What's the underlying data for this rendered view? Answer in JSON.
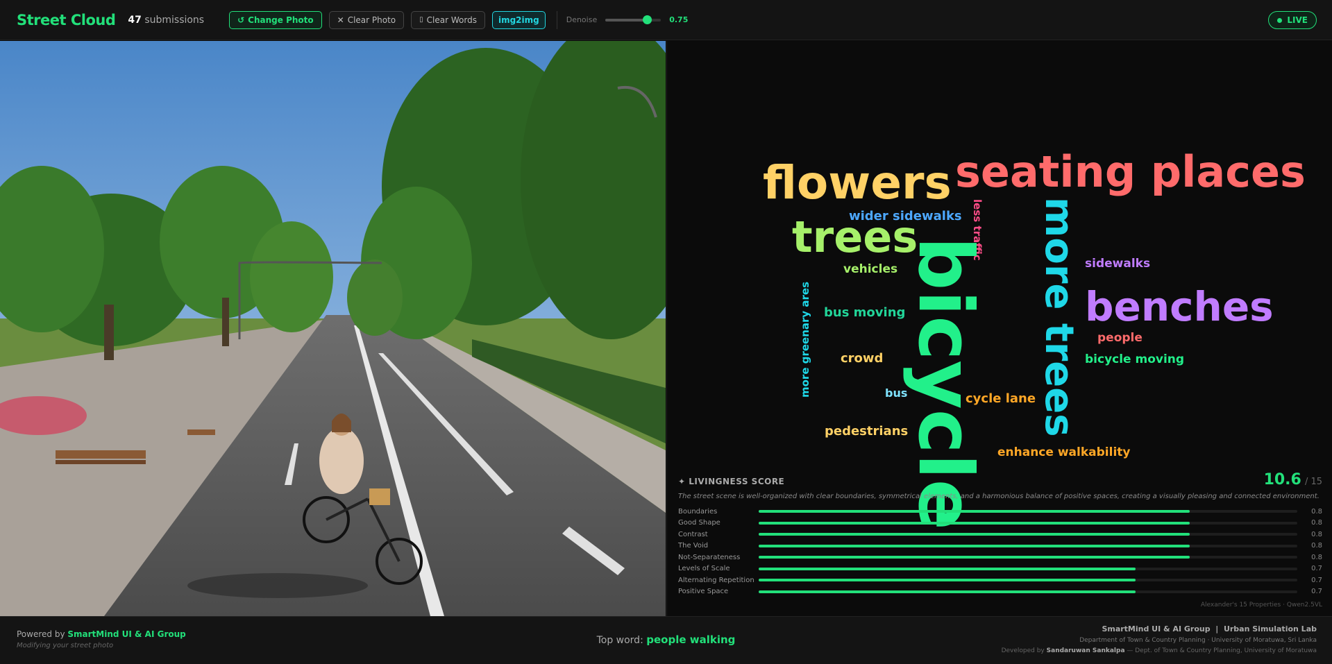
{
  "header": {
    "brand": "Street Cloud",
    "submissions_count": "47",
    "submissions_label": "submissions",
    "change_photo": "Change Photo",
    "clear_photo": "Clear Photo",
    "clear_words": "Clear Words",
    "mode": "img2img",
    "denoise_label": "Denoise",
    "denoise_value": "0.75",
    "denoise_fraction": 0.75,
    "live": "LIVE"
  },
  "cloud": {
    "words": [
      {
        "text": "seating places",
        "color": "#ff6b6b"
      },
      {
        "text": "flowers",
        "color": "#ffd166"
      },
      {
        "text": "wider sidewalks",
        "color": "#4da8ff"
      },
      {
        "text": "less traffic",
        "color": "#ff4d88"
      },
      {
        "text": "trees",
        "color": "#a6f06a"
      },
      {
        "text": "more trees",
        "color": "#1fd8e8"
      },
      {
        "text": "bicycle",
        "color": "#22f08a"
      },
      {
        "text": "vehicles",
        "color": "#a6f06a"
      },
      {
        "text": "sidewalks",
        "color": "#c07cff"
      },
      {
        "text": "more greenary ares",
        "color": "#1fd8e8"
      },
      {
        "text": "benches",
        "color": "#c07cff"
      },
      {
        "text": "bus moving",
        "color": "#22d69a"
      },
      {
        "text": "people",
        "color": "#ff6b6b"
      },
      {
        "text": "crowd",
        "color": "#ffd166"
      },
      {
        "text": "bicycle moving",
        "color": "#22f08a"
      },
      {
        "text": "bus",
        "color": "#7fe3ff"
      },
      {
        "text": "cycle lane",
        "color": "#ffa726"
      },
      {
        "text": "pedestrians",
        "color": "#ffd166"
      },
      {
        "text": "enhance walkability",
        "color": "#ffa726"
      }
    ]
  },
  "score": {
    "title": "LIVINGNESS SCORE",
    "value": "10.6",
    "max": "/ 15",
    "description": "The street scene is well-organized with clear boundaries, symmetrical elements, and a harmonious balance of positive spaces, creating a visually pleasing and connected environment.",
    "properties": [
      {
        "label": "Boundaries",
        "value": "0.8",
        "level": 0.8
      },
      {
        "label": "Good Shape",
        "value": "0.8",
        "level": 0.8
      },
      {
        "label": "Contrast",
        "value": "0.8",
        "level": 0.8
      },
      {
        "label": "The Void",
        "value": "0.8",
        "level": 0.8
      },
      {
        "label": "Not-Separateness",
        "value": "0.8",
        "level": 0.8
      },
      {
        "label": "Levels of Scale",
        "value": "0.7",
        "level": 0.7
      },
      {
        "label": "Alternating Repetition",
        "value": "0.7",
        "level": 0.7
      },
      {
        "label": "Positive Space",
        "value": "0.7",
        "level": 0.7
      }
    ],
    "credit": "Alexander's 15 Properties · Qwen2.5VL"
  },
  "footer": {
    "powered_prefix": "Powered by",
    "powered_by": "SmartMind UI & AI Group",
    "modifying": "Modifying your street photo",
    "top_word_label": "Top word:",
    "top_word": "people walking",
    "org_line": "SmartMind UI & AI Group  |  Urban Simulation Lab",
    "dept_line": "Department of Town & Country Planning · University of Moratuwa, Sri Lanka",
    "developed_prefix": "Developed by",
    "developer": "Sandaruwan Sankalpa",
    "developer_suffix": "— Dept. of Town & Country Planning, University of Moratuwa"
  }
}
